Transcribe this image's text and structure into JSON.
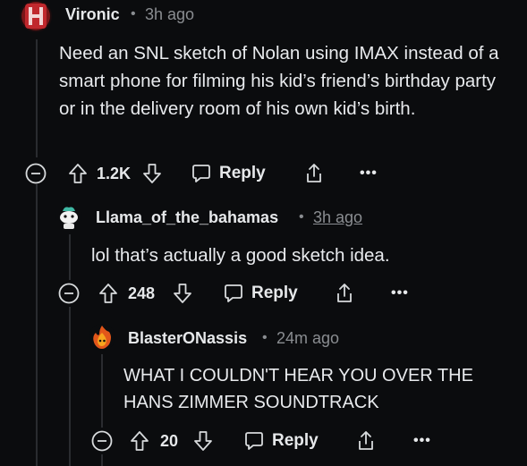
{
  "comments": [
    {
      "username": "Vironic",
      "separator": "•",
      "time": "3h ago",
      "avatar_text": "H",
      "body": "Need an SNL sketch of Nolan using IMAX instead of a smart phone for filming his kid’s friend’s birthday party or in the delivery room of his own kid’s birth.",
      "votes": "1.2K",
      "reply_label": "Reply",
      "more_label": "•••"
    },
    {
      "username": "Llama_of_the_bahamas",
      "separator": "•",
      "time": "3h ago",
      "body": "lol that’s actually a good sketch idea.",
      "votes": "248",
      "reply_label": "Reply",
      "more_label": "•••"
    },
    {
      "username": "BlasterONassis",
      "separator": "•",
      "time": "24m ago",
      "body": "WHAT I COULDN'T HEAR YOU OVER THE HANS ZIMMER SOUNDTRACK",
      "votes": "20",
      "reply_label": "Reply",
      "more_label": "•••"
    }
  ],
  "colors": {
    "background": "#0b0c0e",
    "text": "#e8eaed",
    "muted": "#8a8d91",
    "thread_line": "#2a2c30",
    "avatar_red": "#c0282d"
  }
}
